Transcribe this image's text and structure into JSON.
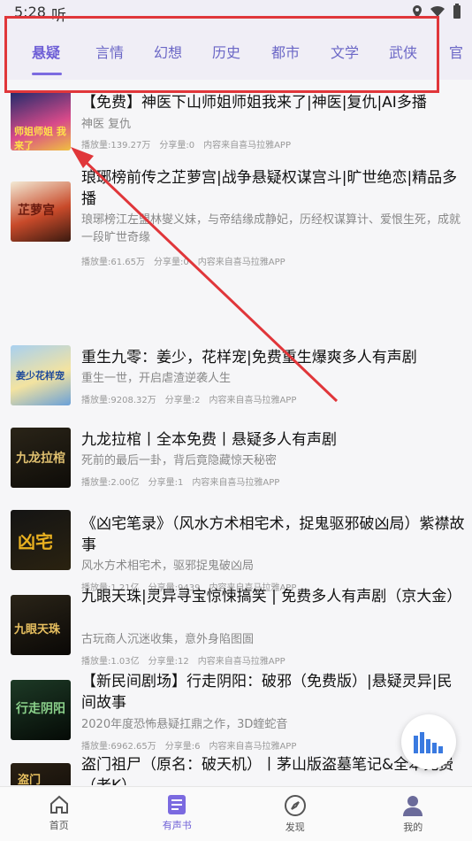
{
  "status_bar": {
    "time": "5:28",
    "carrier": "听"
  },
  "tabs": [
    {
      "label": "悬疑",
      "active": true
    },
    {
      "label": "言情"
    },
    {
      "label": "幻想"
    },
    {
      "label": "历史"
    },
    {
      "label": "都市"
    },
    {
      "label": "文学"
    },
    {
      "label": "武侠"
    },
    {
      "label": "官"
    }
  ],
  "items": [
    {
      "title": "【免费】神医下山师姐师姐我来了|神医|复仇|AI多播",
      "desc": "神医 复仇",
      "plays": "播放量:139.27万",
      "shares": "分享量:0",
      "source": "内容来自喜马拉雅APP",
      "cover_text": "师姐师姐 我来了",
      "cover_color": "#2a3a7a"
    },
    {
      "title": "琅琊榜前传之芷萝宫|战争悬疑权谋宫斗|旷世绝恋|精品多播",
      "desc": "琅琊榜江左盟林燮义妹，与帝结缘成静妃，历经权谋算计、爱恨生死，成就一段旷世奇缘",
      "plays": "播放量:61.65万",
      "shares": "分享量:0",
      "source": "内容来自喜马拉雅APP",
      "cover_text": "芷萝宫",
      "cover_color": "#8a2a1f"
    },
    {
      "title": "重生九零：姜少，花样宠|免费重生爆爽多人有声剧",
      "desc": "重生一世，开启虐渣逆袭人生",
      "plays": "播放量:9208.32万",
      "shares": "分享量:2",
      "source": "内容来自喜马拉雅APP",
      "cover_text": "姜少花样宠",
      "cover_color": "#6aa0d8"
    },
    {
      "title": "九龙拉棺丨全本免费丨悬疑多人有声剧",
      "desc": "死前的最后一卦，背后竟隐藏惊天秘密",
      "plays": "播放量:2.00亿",
      "shares": "分享量:1",
      "source": "内容来自喜马拉雅APP",
      "cover_text": "九龙拉棺",
      "cover_color": "#1d1a14"
    },
    {
      "title": "《凶宅笔录》（风水方术相宅术，捉鬼驱邪破凶局）紫襟故事",
      "desc": "风水方术相宅术，驱邪捉鬼破凶局",
      "plays": "播放量:1.21亿",
      "shares": "分享量:9439",
      "source": "内容来自喜马拉雅APP",
      "cover_text": "凶宅",
      "cover_color": "#141414"
    },
    {
      "title": "九眼天珠|灵异寻宝惊悚搞笑 | 免费多人有声剧（京大金）",
      "desc": "古玩商人沉迷收集，意外身陷图圄",
      "plays": "播放量:1.03亿",
      "shares": "分享量:12",
      "source": "内容来自喜马拉雅APP",
      "cover_text": "九眼天珠",
      "cover_color": "#1a1510"
    },
    {
      "title": "【新民间剧场】行走阴阳：破邪（免费版）|悬疑灵异|民间故事",
      "desc": "2020年度恐怖悬疑扛鼎之作，3D蝰蛇音",
      "plays": "播放量:6962.65万",
      "shares": "分享量:6",
      "source": "内容来自喜马拉雅APP",
      "cover_text": "行走阴阳",
      "cover_color": "#102418"
    },
    {
      "title": "盗门祖尸（原名：破天机）丨茅山版盗墓笔记&全本免费（老K）",
      "desc": "",
      "plays": "",
      "shares": "",
      "source": "",
      "cover_text": "盗门",
      "cover_color": "#201a14"
    }
  ],
  "bottom_nav": [
    {
      "label": "首页",
      "icon": "home-icon"
    },
    {
      "label": "有声书",
      "icon": "book-icon",
      "active": true
    },
    {
      "label": "发现",
      "icon": "compass-icon"
    },
    {
      "label": "我的",
      "icon": "user-icon"
    }
  ],
  "colors": {
    "accent": "#6e5fd6",
    "highlight": "#e0363a"
  }
}
